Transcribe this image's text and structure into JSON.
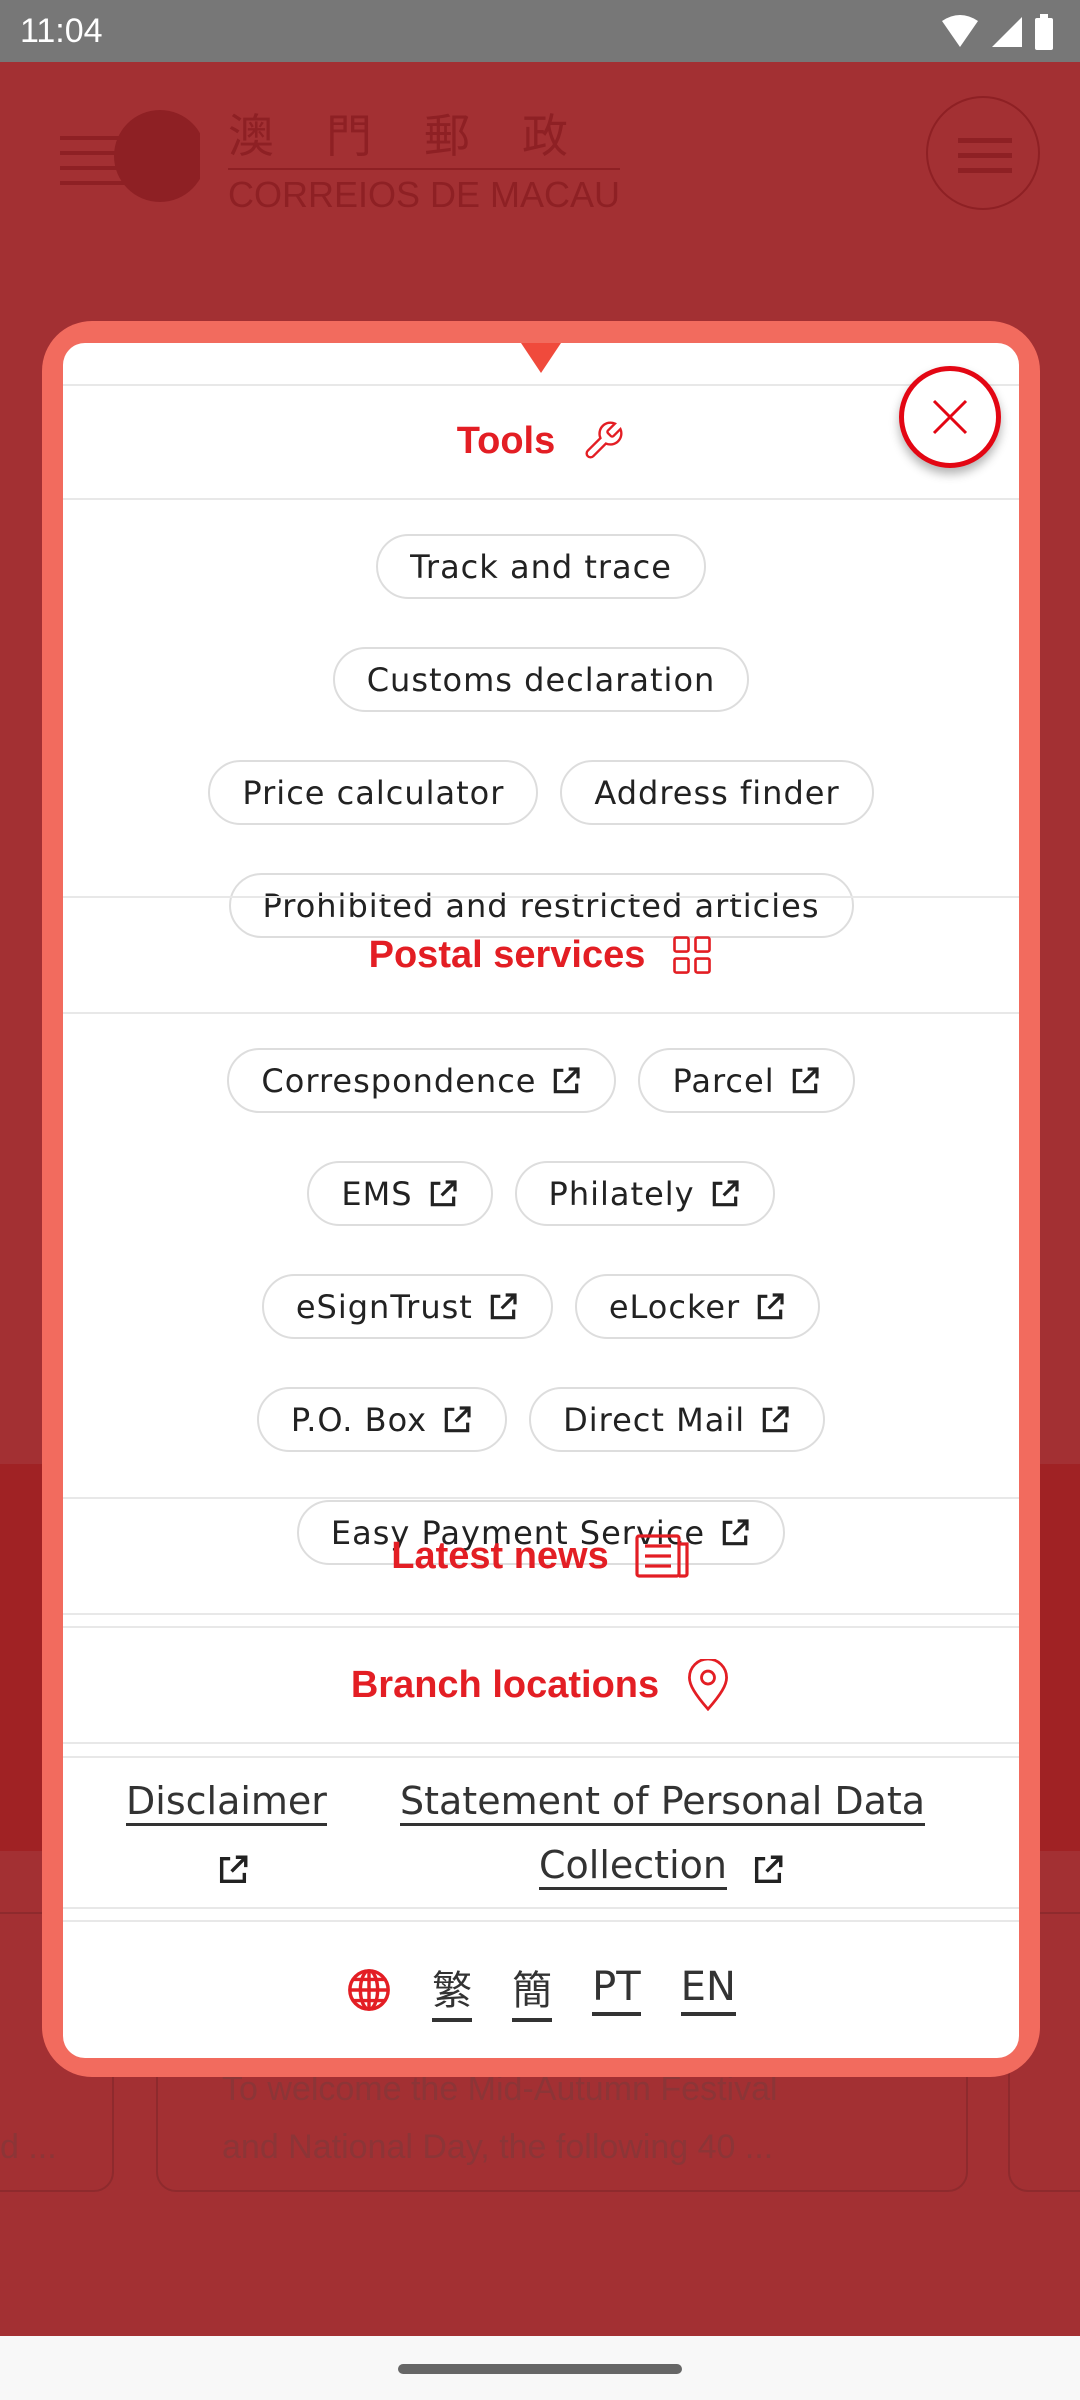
{
  "status_bar": {
    "time": "11:04",
    "icons": [
      "wifi-icon",
      "signal-icon",
      "battery-icon"
    ]
  },
  "background": {
    "logo_cn": "澳門郵政",
    "logo_pt": "CORREIOS DE MACAU",
    "card_text_line1": "To welcome the Mid-Autumn Festival",
    "card_text_line2": "and National Day, the following 40 ...",
    "left_card_text": "d ..."
  },
  "menu": {
    "tools": {
      "title": "Tools",
      "icon": "wrench-icon",
      "items": [
        "Track and trace",
        "Customs declaration",
        "Price calculator",
        "Address finder",
        "Prohibited and restricted articles"
      ]
    },
    "postal_services": {
      "title": "Postal services",
      "icon": "grid-icon",
      "items": [
        "Correspondence",
        "Parcel",
        "EMS",
        "Philately",
        "eSignTrust",
        "eLocker",
        "P.O. Box",
        "Direct Mail",
        "Easy Payment Service"
      ]
    },
    "latest_news": {
      "title": "Latest news",
      "icon": "newspaper-icon"
    },
    "branch_locations": {
      "title": "Branch locations",
      "icon": "map-pin-icon"
    },
    "footer_links": {
      "disclaimer": "Disclaimer",
      "personal_data_line1": "Statement of Personal Data",
      "personal_data_line2": "Collection"
    },
    "languages": [
      "繁",
      "簡",
      "PT",
      "EN"
    ]
  },
  "colors": {
    "accent": "#e31e24",
    "modal_border": "#f26b5e",
    "backdrop": "#a33033"
  }
}
